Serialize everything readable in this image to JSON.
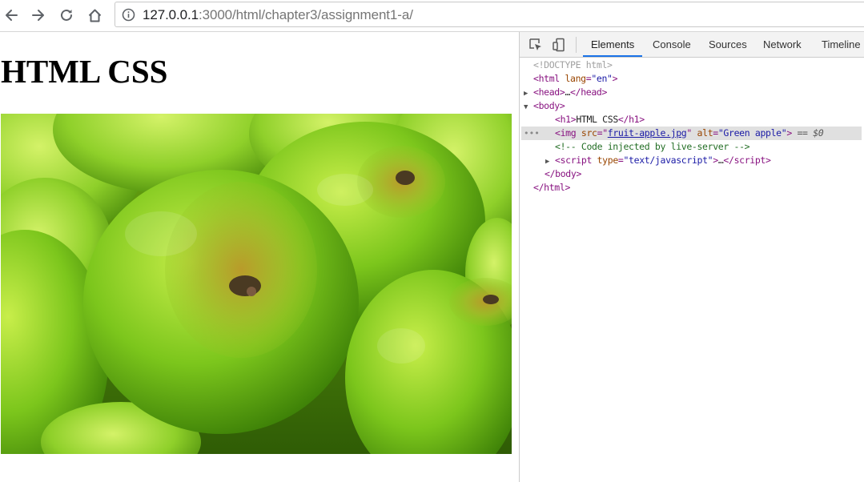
{
  "browser": {
    "url_host": "127.0.0.1",
    "url_path": ":3000/html/chapter3/assignment1-a/"
  },
  "page": {
    "heading": "HTML CSS",
    "image_alt": "Green apple"
  },
  "devtools": {
    "tabs": [
      "Elements",
      "Console",
      "Sources",
      "Network",
      "Timeline"
    ],
    "active_tab": "Elements",
    "dom": {
      "doctype": "<!DOCTYPE html>",
      "html_open": "html",
      "lang_attr": "lang",
      "lang_value": "\"en\"",
      "head": "head",
      "head_ellipsis": "…",
      "body": "body",
      "h1_tag": "h1",
      "h1_text": "HTML CSS",
      "img_tag": "img",
      "src_attr": "src",
      "src_value": "fruit-apple.jpg",
      "alt_attr": "alt",
      "alt_value": "\"Green apple\"",
      "selected_marker": "== $0",
      "comment": "<!-- Code injected by live-server -->",
      "script_tag": "script",
      "type_attr": "type",
      "type_value": "\"text/javascript\"",
      "script_ellipsis": "…",
      "body_close": "body",
      "html_close": "html"
    }
  }
}
